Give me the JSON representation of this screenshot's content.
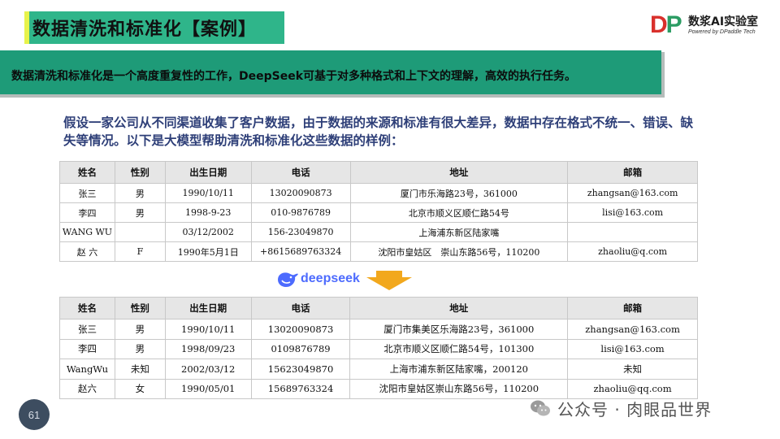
{
  "header": {
    "title": "数据清洗和标准化【案例】",
    "logo": {
      "mark": "DP",
      "mark_small": "addle",
      "name": "数浆AI实验室",
      "tagline": "Powered by DPaddle Tech"
    }
  },
  "banner": {
    "text": "数据清洗和标准化是一个高度重复性的工作，DeepSeek可基于对多种格式和上下文的理解，高效的执行任务。"
  },
  "intro": {
    "text": "假设一家公司从不同渠道收集了客户数据，由于数据的来源和标准有很大差异，数据中存在格式不统一、错误、缺失等情况。以下是大模型帮助清洗和标准化这些数据的样例："
  },
  "table_before": {
    "headers": [
      "姓名",
      "性别",
      "出生日期",
      "电话",
      "地址",
      "邮箱"
    ],
    "rows": [
      [
        "张三",
        "男",
        "1990/10/11",
        "13020090873",
        "厦门市乐海路23号，361000",
        "zhangsan@163.com"
      ],
      [
        "李四",
        "男",
        "1998-9-23",
        "010-9876789",
        "北京市顺义区顺仁路54号",
        "lisi@163.com"
      ],
      [
        "WANG WU",
        "",
        "03/12/2002",
        "156-23049870",
        "上海浦东新区陆家嘴",
        ""
      ],
      [
        "赵 六",
        "F",
        "1990年5月1日",
        "+8615689763324",
        "沈阳市皇姑区　崇山东路56号，110200",
        "zhaoliu@q.com"
      ]
    ]
  },
  "transition": {
    "brand": "deepseek",
    "icon": "deepseek-whale-icon",
    "arrow_color": "#f2a81d"
  },
  "table_after": {
    "headers": [
      "姓名",
      "性别",
      "出生日期",
      "电话",
      "地址",
      "邮箱"
    ],
    "rows": [
      [
        "张三",
        "男",
        "1990/10/11",
        "13020090873",
        "厦门市集美区乐海路23号，361000",
        "zhangsan@163.com"
      ],
      [
        "李四",
        "男",
        "1998/09/23",
        "0109876789",
        "北京市顺义区顺仁路54号，101300",
        "lisi@163.com"
      ],
      [
        "WangWu",
        "未知",
        "2002/03/12",
        "15623049870",
        "上海市浦东新区陆家嘴，200120",
        "未知"
      ],
      [
        "赵六",
        "女",
        "1990/05/01",
        "15689763324",
        "沈阳市皇姑区崇山东路56号，110200",
        "zhaoliu@qq.com"
      ]
    ]
  },
  "footer": {
    "page_number": "61",
    "watermark": "公众号 · 肉眼品世界"
  },
  "colors": {
    "title_green": "#2fb58a",
    "title_accent": "#e7f34b",
    "banner_green": "#1e9b78",
    "intro_blue": "#2e3f78",
    "deepseek_blue": "#4d6bfe",
    "logo_red": "#d9302c"
  }
}
